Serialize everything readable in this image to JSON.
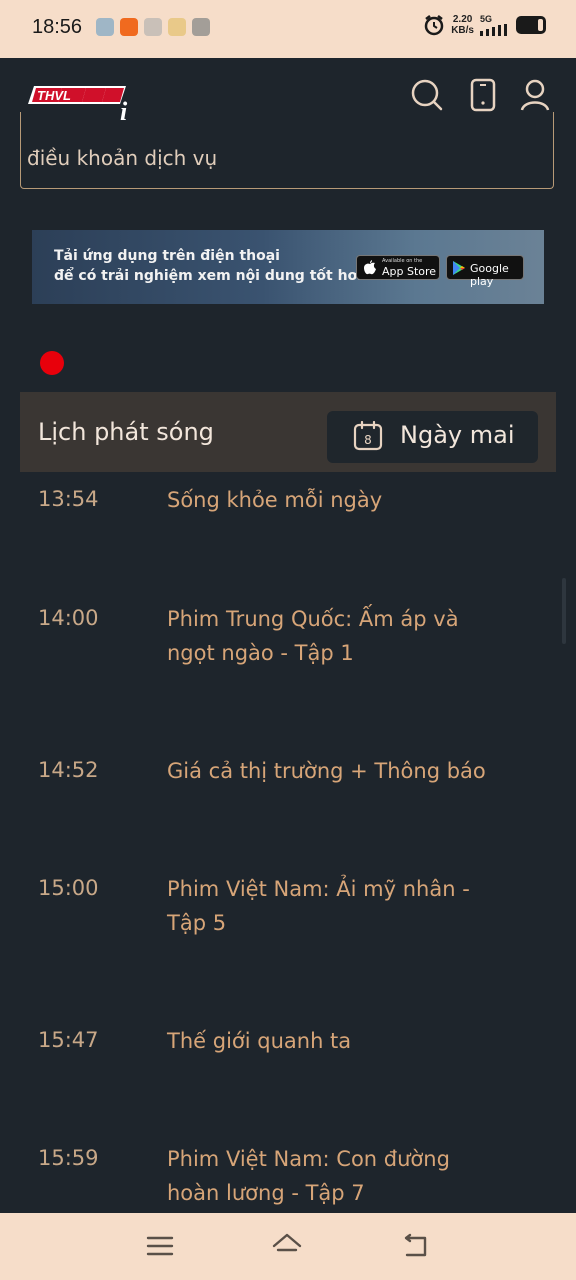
{
  "status_bar": {
    "time": "18:56",
    "speed_value": "2.20",
    "speed_unit": "KB/s",
    "network": "5G",
    "icons": [
      "gallery-icon",
      "video-app-icon",
      "wifi-app-icon",
      "notes-icon",
      "fourg-icon",
      "alarm-icon",
      "signal-icon",
      "battery-icon"
    ]
  },
  "header": {
    "logo_text": "THVL",
    "logo_suffix": "i",
    "icons": [
      "search-icon",
      "phone-icon",
      "user-icon"
    ]
  },
  "terms": {
    "text": "điều khoản dịch vụ"
  },
  "banner": {
    "line1": "Tải ứng dụng trên điện thoại",
    "line2": "để có trải nghiệm xem nội dung tốt hơn",
    "appstore_small": "Available on the",
    "appstore_big": "App Store",
    "googleplay_big": "Google play"
  },
  "schedule": {
    "title": "Lịch phát sóng",
    "day_button": "Ngày mai",
    "calendar_day": "8",
    "items": [
      {
        "time": "13:54",
        "title": "Sống khỏe mỗi ngày"
      },
      {
        "time": "14:00",
        "title": "Phim Trung Quốc: Ấm áp và ngọt ngào - Tập 1"
      },
      {
        "time": "14:52",
        "title": "Giá cả thị trường + Thông báo"
      },
      {
        "time": "15:00",
        "title": "Phim Việt Nam: Ải mỹ nhân - Tập 5"
      },
      {
        "time": "15:47",
        "title": "Thế giới quanh ta"
      },
      {
        "time": "15:59",
        "title": "Phim Việt Nam: Con đường hoàn lương - Tập 7"
      }
    ]
  },
  "nav_bar": {
    "icons": [
      "menu-icon",
      "home-icon",
      "back-icon"
    ]
  },
  "colors": {
    "background": "#1e252c",
    "accent_text": "#d7a578",
    "status_bar": "#f6ddc9",
    "live_dot": "#e8000b"
  }
}
